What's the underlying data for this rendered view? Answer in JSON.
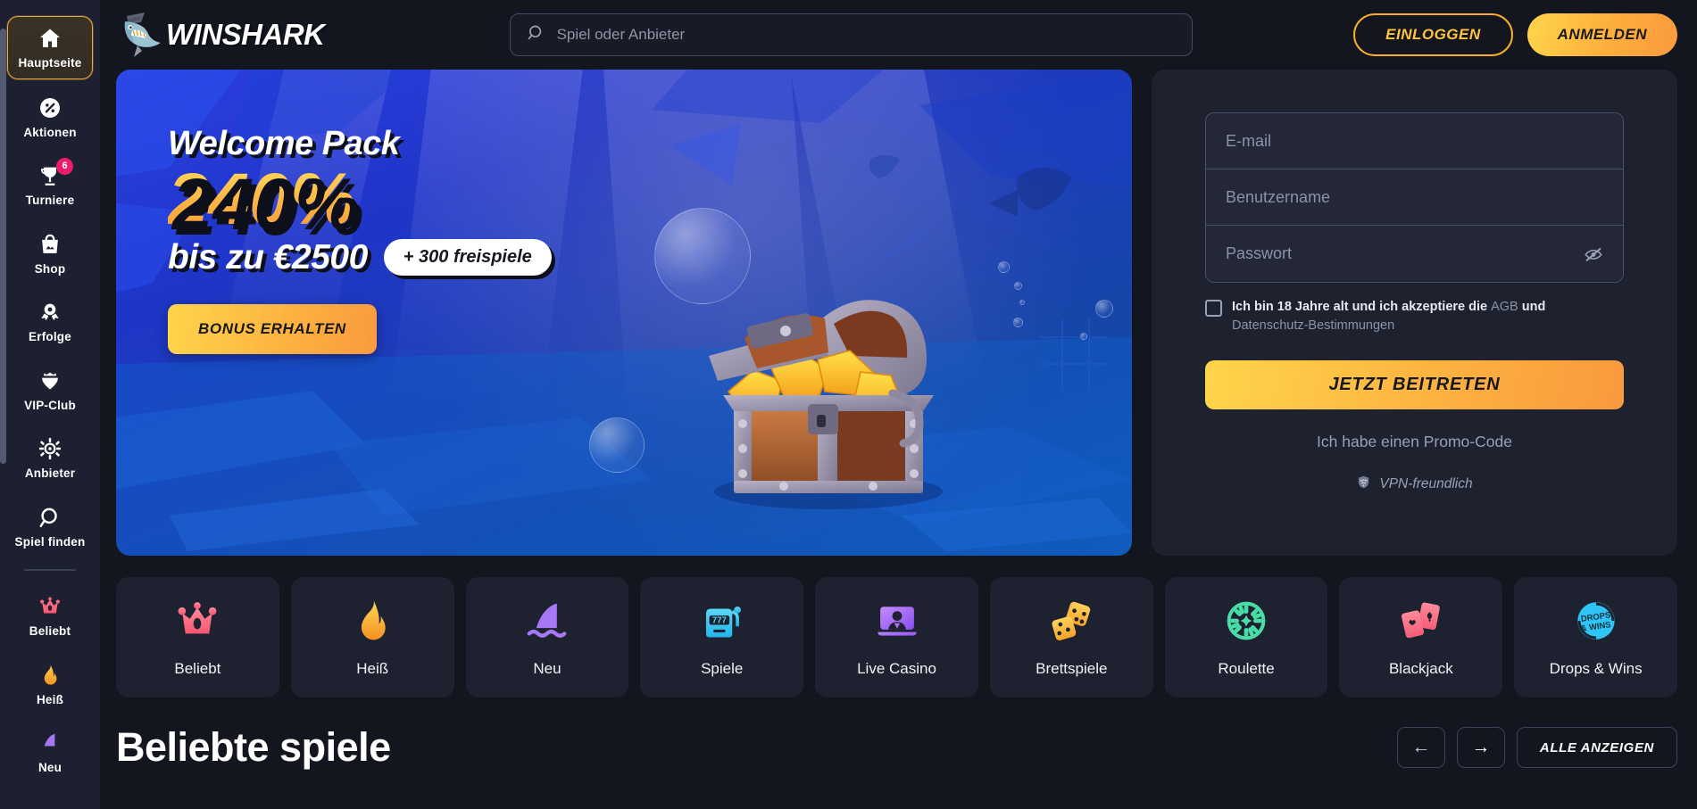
{
  "brand": {
    "name": "WINSHARK",
    "logo_icon": "shark-logo-icon"
  },
  "sidebar": {
    "items": [
      {
        "label": "Hauptseite",
        "icon": "home-icon",
        "active": true
      },
      {
        "label": "Aktionen",
        "icon": "percent-circle-icon",
        "active": false
      },
      {
        "label": "Turniere",
        "icon": "trophy-icon",
        "active": false,
        "badge": "6"
      },
      {
        "label": "Shop",
        "icon": "shopping-bag-icon",
        "active": false
      },
      {
        "label": "Erfolge",
        "icon": "award-medal-icon",
        "active": false
      },
      {
        "label": "VIP-Club",
        "icon": "crown-heart-icon",
        "active": false
      },
      {
        "label": "Anbieter",
        "icon": "ship-wheel-icon",
        "active": false
      },
      {
        "label": "Spiel finden",
        "icon": "search-icon",
        "active": false
      }
    ],
    "quick_items": [
      {
        "label": "Beliebt",
        "icon": "crown-icon",
        "color": "#f8788f"
      },
      {
        "label": "Heiß",
        "icon": "flame-icon",
        "color": "#f9b42e"
      },
      {
        "label": "Neu",
        "icon": "shark-fin-icon",
        "color": "#a678f5"
      }
    ]
  },
  "search": {
    "placeholder": "Spiel oder Anbieter",
    "icon": "search-icon"
  },
  "auth": {
    "login_label": "EINLOGGEN",
    "register_label": "ANMELDEN"
  },
  "banner": {
    "title": "Welcome Pack",
    "percent": "240%",
    "upto": "bis zu €2500",
    "spins_badge": "+ 300 freispiele",
    "cta_label": "BONUS ERHALTEN",
    "art": "underwater-treasure-chest"
  },
  "signup": {
    "email_placeholder": "E-mail",
    "username_placeholder": "Benutzername",
    "password_placeholder": "Passwort",
    "password_toggle_icon": "eye-off-icon",
    "terms_prefix": "Ich bin 18 Jahre alt und ich akzeptiere die ",
    "terms_link1": "AGB",
    "terms_middle": " und ",
    "terms_link2": "Datenschutz-Bestimmungen",
    "submit_label": "JETZT BEITRETEN",
    "promo_label": "Ich habe einen Promo-Code",
    "vpn_label": "VPN-freundlich",
    "vpn_icon": "shield-vpn-icon"
  },
  "categories": [
    {
      "label": "Beliebt",
      "icon": "crown-icon",
      "color": "#f8788f"
    },
    {
      "label": "Heiß",
      "icon": "flame-icon",
      "color": "#f9b42e"
    },
    {
      "label": "Neu",
      "icon": "shark-fin-icon",
      "color": "#a678f5"
    },
    {
      "label": "Spiele",
      "icon": "slot-machine-777-icon",
      "color": "#34c6ef"
    },
    {
      "label": "Live Casino",
      "icon": "live-dealer-icon",
      "color": "#b06df7"
    },
    {
      "label": "Brettspiele",
      "icon": "dice-icon",
      "color": "#fbb942"
    },
    {
      "label": "Roulette",
      "icon": "roulette-wheel-icon",
      "color": "#49dca6"
    },
    {
      "label": "Blackjack",
      "icon": "playing-cards-icon",
      "color": "#f8788f"
    },
    {
      "label": "Drops & Wins",
      "icon": "drops-and-wins-icon",
      "color": "#2ec4f5"
    }
  ],
  "section": {
    "title": "Beliebte spiele",
    "prev_icon": "arrow-left-icon",
    "next_icon": "arrow-right-icon",
    "show_all_label": "ALLE ANZEIGEN"
  },
  "colors": {
    "accent_gold": "#fcb140",
    "accent_pink": "#ec1c6a",
    "page_bg": "#14161f",
    "panel_bg": "#1e212e",
    "sidebar_bg": "#1c2031"
  }
}
